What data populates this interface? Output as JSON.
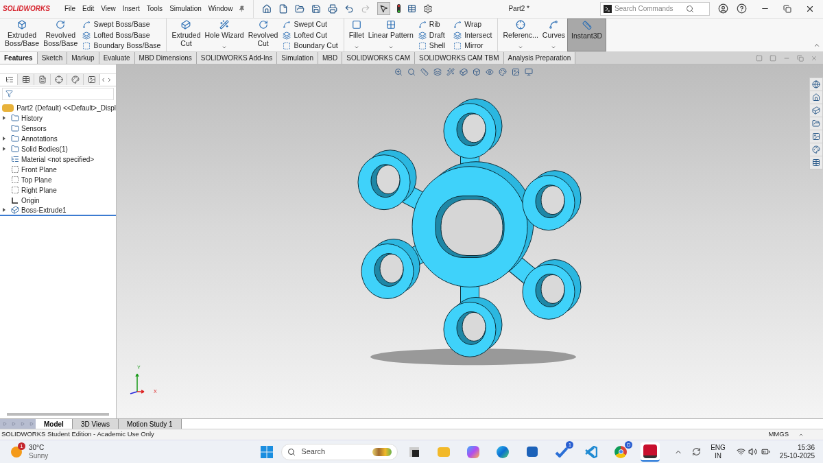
{
  "app": {
    "logo": "SOLIDWORKS",
    "menu": [
      "File",
      "Edit",
      "View",
      "Insert",
      "Tools",
      "Simulation",
      "Window"
    ],
    "title": "Part2 *",
    "search": {
      "placeholder": "Search Commands"
    }
  },
  "ribbon": {
    "columns": [
      {
        "kind": "large",
        "lines": [
          "Extruded",
          "Boss/Base"
        ],
        "dropdown": false,
        "on": false
      },
      {
        "kind": "large",
        "lines": [
          "Revolved",
          "Boss/Base"
        ],
        "dropdown": false,
        "on": false
      },
      {
        "kind": "small",
        "items": [
          "Swept Boss/Base",
          "Lofted Boss/Base",
          "Boundary Boss/Base"
        ]
      },
      {
        "kind": "large",
        "lines": [
          "Extruded",
          "Cut"
        ],
        "dropdown": false,
        "on": false
      },
      {
        "kind": "large",
        "lines": [
          "Hole Wizard"
        ],
        "dropdown": true,
        "on": false
      },
      {
        "kind": "large",
        "lines": [
          "Revolved",
          "Cut"
        ],
        "dropdown": false,
        "on": false
      },
      {
        "kind": "small",
        "items": [
          "Swept Cut",
          "Lofted Cut",
          "Boundary Cut"
        ]
      },
      {
        "kind": "large",
        "lines": [
          "Fillet"
        ],
        "dropdown": true,
        "on": false
      },
      {
        "kind": "large",
        "lines": [
          "Linear Pattern"
        ],
        "dropdown": true,
        "on": false
      },
      {
        "kind": "small",
        "items": [
          "Rib",
          "Draft",
          "Shell"
        ]
      },
      {
        "kind": "small",
        "items": [
          "Wrap",
          "Intersect",
          "Mirror"
        ]
      },
      {
        "kind": "large",
        "lines": [
          "Referenc..."
        ],
        "dropdown": true,
        "on": false
      },
      {
        "kind": "large",
        "lines": [
          "Curves"
        ],
        "dropdown": true,
        "on": false
      },
      {
        "kind": "large",
        "lines": [
          "Instant3D"
        ],
        "dropdown": false,
        "on": true
      }
    ]
  },
  "command_tabs": [
    {
      "label": "Features",
      "selected": true
    },
    {
      "label": "Sketch",
      "selected": false
    },
    {
      "label": "Markup",
      "selected": false
    },
    {
      "label": "Evaluate",
      "selected": false
    },
    {
      "label": "MBD Dimensions",
      "selected": false
    },
    {
      "label": "SOLIDWORKS Add-Ins",
      "selected": false
    },
    {
      "label": "Simulation",
      "selected": false
    },
    {
      "label": "MBD",
      "selected": false
    },
    {
      "label": "SOLIDWORKS CAM",
      "selected": false
    },
    {
      "label": "SOLIDWORKS CAM TBM",
      "selected": false
    },
    {
      "label": "Analysis Preparation",
      "selected": false
    }
  ],
  "panel_tabs": [
    {
      "selected": true
    },
    {
      "selected": false
    },
    {
      "selected": false
    },
    {
      "selected": false
    },
    {
      "selected": false
    },
    {
      "selected": false
    }
  ],
  "feature_tree": {
    "root": "Part2 (Default) <<Default>_Displ",
    "items": [
      {
        "kind": "folder",
        "label": "History",
        "expandable": true
      },
      {
        "kind": "folder",
        "label": "Sensors",
        "expandable": false
      },
      {
        "kind": "folder",
        "label": "Annotations",
        "expandable": true
      },
      {
        "kind": "folder",
        "label": "Solid Bodies(1)",
        "expandable": true
      },
      {
        "kind": "material",
        "label": "Material <not specified>",
        "expandable": false
      },
      {
        "kind": "plane",
        "label": "Front Plane",
        "expandable": false
      },
      {
        "kind": "plane",
        "label": "Top Plane",
        "expandable": false
      },
      {
        "kind": "plane",
        "label": "Right Plane",
        "expandable": false
      },
      {
        "kind": "origin",
        "label": "Origin",
        "expandable": false
      },
      {
        "kind": "feature",
        "label": "Boss-Extrude1",
        "expandable": true
      }
    ]
  },
  "triad": {
    "y": "Y",
    "x": "X"
  },
  "bottom_tabs": [
    {
      "label": "Model",
      "selected": true
    },
    {
      "label": "3D Views",
      "selected": false
    },
    {
      "label": "Motion Study 1",
      "selected": false
    }
  ],
  "status_bar": {
    "text": "SOLIDWORKS Student Edition - Academic Use Only",
    "units": "MMGS"
  },
  "taskbar": {
    "weather": {
      "temp": "30°C",
      "condition": "Sunny",
      "badge": "1"
    },
    "search": {
      "placeholder": "Search"
    },
    "apps": [
      {
        "kind": "taskview",
        "selected": false
      },
      {
        "kind": "explorer",
        "selected": false
      },
      {
        "kind": "copilot",
        "selected": false
      },
      {
        "kind": "edge",
        "selected": false
      },
      {
        "kind": "store",
        "selected": false
      },
      {
        "kind": "todo",
        "badge": "1",
        "selected": false
      },
      {
        "kind": "vscode",
        "selected": false
      },
      {
        "kind": "chrome",
        "badge": "D",
        "selected": false
      },
      {
        "kind": "solidworks",
        "selected": true
      }
    ],
    "language": "ENG",
    "region": "IN",
    "time": "15:36",
    "date": "25-10-2025"
  }
}
